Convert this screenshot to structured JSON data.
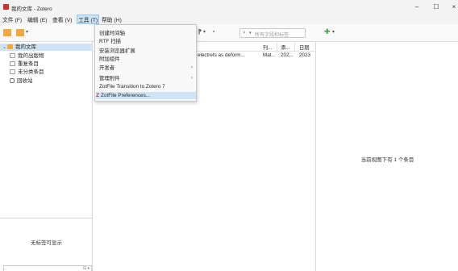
{
  "window": {
    "title": "我的文库 - Zotero",
    "controls": {
      "minimize": "–",
      "maximize": "☐",
      "close": "×"
    }
  },
  "menubar": {
    "items": [
      "文件 (F)",
      "编辑 (E)",
      "查看 (V)",
      "工具 (T)",
      "帮助 (H)"
    ],
    "active_index": 3
  },
  "toolbar": {
    "search_placeholder": "所有字段和标签",
    "search_caret": "▾",
    "caret": "▾",
    "attach_icon": "⁋",
    "locate_icon": "◔",
    "add_note_icon": "✚"
  },
  "tools_menu": {
    "items": [
      {
        "label": "创建时间轴",
        "submenu": false
      },
      {
        "label": "RTF 扫描",
        "submenu": false
      },
      {
        "label": "安装浏览器扩展",
        "submenu": false
      },
      {
        "label": "附加组件",
        "submenu": false
      },
      {
        "label": "开发者",
        "submenu": true
      },
      {
        "label": "管理附件",
        "submenu": true
      },
      {
        "label": "ZotFile Transition to Zotero 7",
        "submenu": false
      },
      {
        "label": "ZotFile Preferences...",
        "submenu": false,
        "highlighted": true,
        "badge": "Z"
      }
    ],
    "submenu_arrow": "›"
  },
  "library_tree": {
    "items": [
      {
        "label": "我的文库",
        "icon": "library-folder-icon",
        "expanded": true,
        "selected": true
      },
      {
        "label": "我的出版物",
        "icon": "document-icon"
      },
      {
        "label": "重复条目",
        "icon": "document-icon"
      },
      {
        "label": "未分类条目",
        "icon": "document-icon"
      },
      {
        "label": "回收站",
        "icon": "trash-icon"
      }
    ],
    "expand_chevron": "⌄",
    "no_tags": "无标签可显示",
    "tag_filter_icon": "⊟ ▾"
  },
  "items_table": {
    "columns": [
      "刊...",
      "添...",
      "日期"
    ],
    "rows": [
      {
        "title": "electrets as deform...",
        "publication": "Mat...",
        "added": "202...",
        "date": "2023"
      }
    ]
  },
  "item_pane": {
    "message": "当前视图下有 1 个条目"
  }
}
